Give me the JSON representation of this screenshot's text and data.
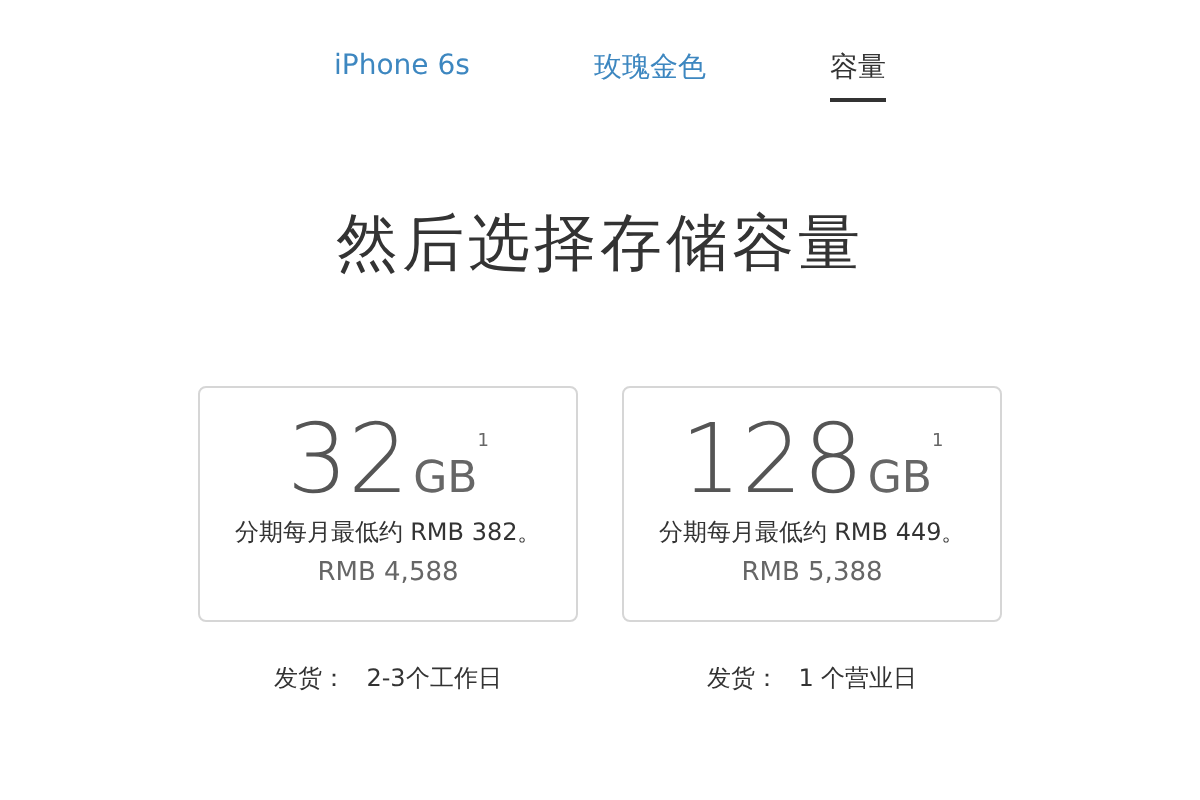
{
  "tabs": [
    {
      "label": "iPhone 6s",
      "selected": false
    },
    {
      "label": "玫瑰金色",
      "selected": false
    },
    {
      "label": "容量",
      "selected": true
    }
  ],
  "heading": "然后选择存储容量",
  "options": [
    {
      "amount": "32",
      "unit": "GB",
      "footnote": "1",
      "installment": "分期每月最低约 RMB 382。",
      "price": "RMB 4,588",
      "shipping_label": "发货：",
      "shipping_time": "2-3个工作日"
    },
    {
      "amount": "128",
      "unit": "GB",
      "footnote": "1",
      "installment": "分期每月最低约 RMB 449。",
      "price": "RMB 5,388",
      "shipping_label": "发货：",
      "shipping_time": "1 个营业日"
    }
  ]
}
